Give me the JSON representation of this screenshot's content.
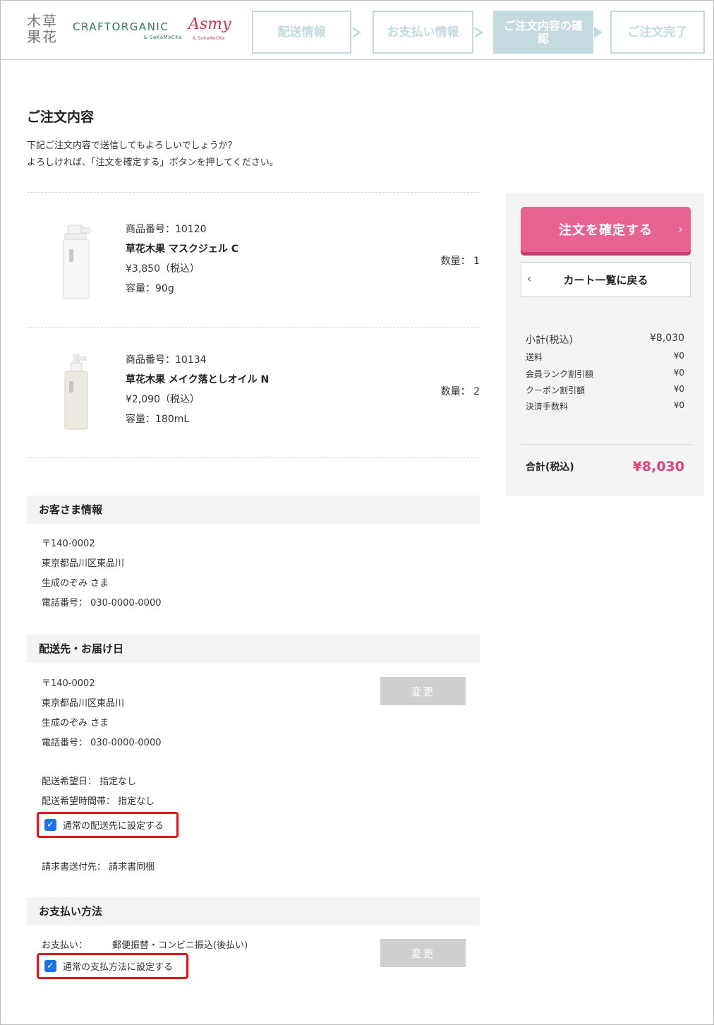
{
  "header": {
    "logo_kanji": [
      "木草",
      "果花"
    ],
    "logo_craft": "CRAFTORGANIC",
    "logo_craft_sub": "& SoKaMoCKa",
    "logo_asmy": "Asmy",
    "logo_asmy_sub": "& SoKaMoCKa",
    "steps": [
      {
        "label": "配送情報",
        "active": false
      },
      {
        "label": "お支払い情報",
        "active": false
      },
      {
        "label": "ご注文内容の確認",
        "active": true
      },
      {
        "label": "ご注文完了",
        "active": false
      }
    ],
    "step_color": "#c3dbde"
  },
  "page": {
    "title": "ご注文内容",
    "intro_line1": "下記ご注文内容で送信してもよろしいでしょうか？",
    "intro_line2": "よろしければ、「注文を確定する」ボタンを押してください。"
  },
  "items": [
    {
      "number": "商品番号：10120",
      "name": "草花木果 マスクジェル C",
      "price": "¥3,850（税込）",
      "volume": "容量：90g",
      "qty": "数量： 1",
      "image_icon": "pump-bottle-icon"
    },
    {
      "number": "商品番号：10134",
      "name": "草花木果 メイク落としオイル N",
      "price": "¥2,090（税込）",
      "volume": "容量：180mL",
      "qty": "数量： 2",
      "image_icon": "pump-bottle-icon"
    }
  ],
  "customer": {
    "heading": "お客さま情報",
    "postal": "〒140-0002",
    "address": "東京都品川区東品川",
    "name": "生成のぞみ さま",
    "phone": "電話番号： 030-0000-0000"
  },
  "delivery": {
    "heading": "配送先・お届け日",
    "postal": "〒140-0002",
    "address": "東京都品川区東品川",
    "name": "生成のぞみ さま",
    "phone": "電話番号： 030-0000-0000",
    "change_label": "変更",
    "date": "配送希望日： 指定なし",
    "time": "配送希望時間帯： 指定なし",
    "default_checkbox": "通常の配送先に設定する",
    "invoice": "請求書送付先： 請求書同梱"
  },
  "payment": {
    "heading": "お支払い方法",
    "label": "お支払い：",
    "method": "郵便振替・コンビニ振込(後払い)",
    "change_label": "変更",
    "default_checkbox": "通常の支払方法に設定する"
  },
  "sidebar": {
    "confirm_label": "注文を確定する",
    "back_label": "カート一覧に戻る",
    "summary": [
      {
        "label": "小計(税込)",
        "value": "¥8,030"
      },
      {
        "label": "送料",
        "value": "¥0"
      },
      {
        "label": "会員ランク割引額",
        "value": "¥0"
      },
      {
        "label": "クーポン割引額",
        "value": "¥0"
      },
      {
        "label": "決済手数料",
        "value": "¥0"
      }
    ],
    "total_label": "合計(税込)",
    "total_value": "¥8,030",
    "accent_color": "#e86292",
    "total_color": "#e0407a"
  },
  "highlight_color": "#e2141c"
}
